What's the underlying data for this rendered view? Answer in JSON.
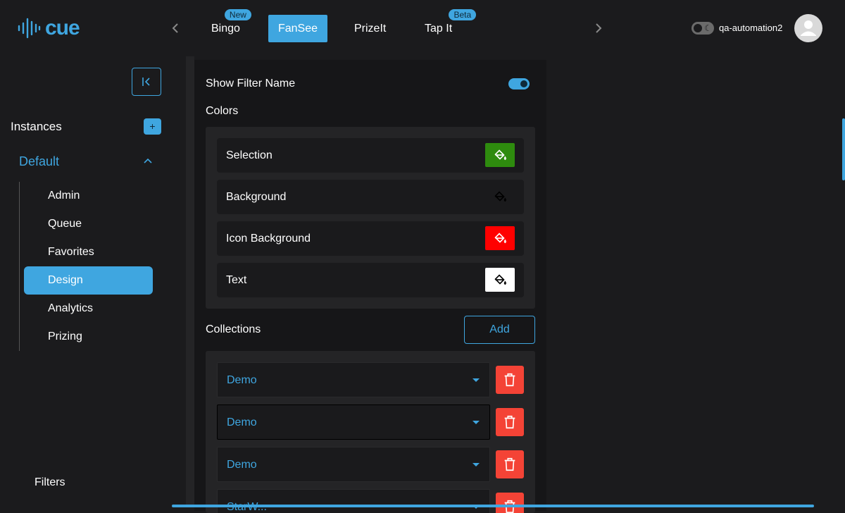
{
  "app": {
    "logo_text": "cue"
  },
  "header": {
    "tabs": [
      {
        "label": "Bingo",
        "badge": "New"
      },
      {
        "label": "FanSee",
        "badge": ""
      },
      {
        "label": "PrizeIt",
        "badge": ""
      },
      {
        "label": "Tap It",
        "badge": "Beta"
      }
    ],
    "active_tab": "FanSee",
    "username": "qa-automation2"
  },
  "sidebar": {
    "instances_label": "Instances",
    "add_label": "+",
    "instance_name": "Default",
    "items": [
      {
        "label": "Admin"
      },
      {
        "label": "Queue"
      },
      {
        "label": "Favorites"
      },
      {
        "label": "Design"
      },
      {
        "label": "Analytics"
      },
      {
        "label": "Prizing"
      }
    ],
    "active_item": "Design",
    "filters_label": "Filters"
  },
  "main": {
    "show_filter_name_label": "Show Filter Name",
    "show_filter_name_on": true,
    "colors_label": "Colors",
    "colors": [
      {
        "label": "Selection",
        "color": "#2e8b0e"
      },
      {
        "label": "Background",
        "color": "#1a1a1c"
      },
      {
        "label": "Icon Background",
        "color": "#ff0000"
      },
      {
        "label": "Text",
        "color": "#ffffff"
      }
    ],
    "collections_label": "Collections",
    "add_button_label": "Add",
    "collections": [
      {
        "value": "Demo"
      },
      {
        "value": "Demo"
      },
      {
        "value": "Demo"
      },
      {
        "value": "StarW..."
      }
    ]
  },
  "theme": {
    "accent": "#3fa6e0",
    "danger": "#f44336",
    "bg": "#1b1b1d"
  }
}
